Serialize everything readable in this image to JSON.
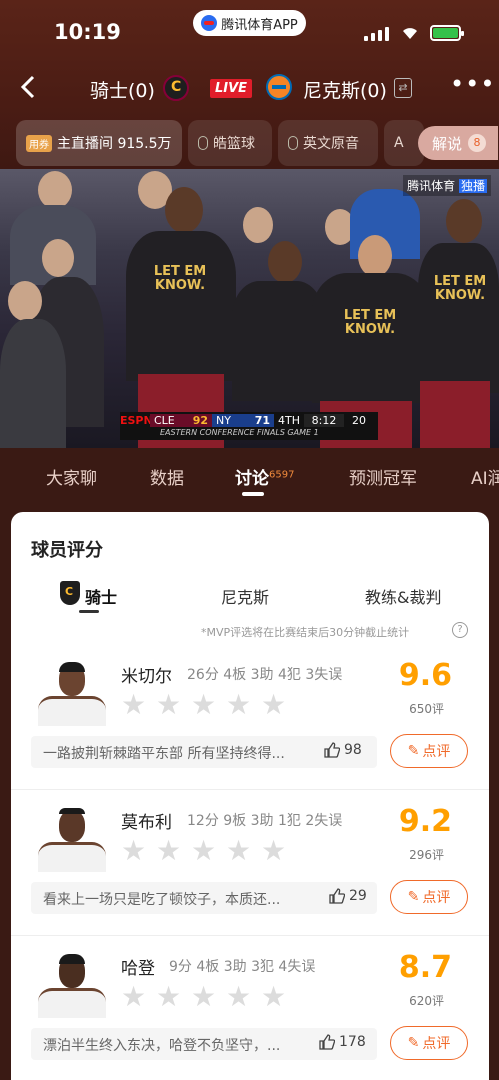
{
  "status_bar": {
    "time": "10:19",
    "app_name": "腾讯体育APP"
  },
  "header": {
    "home_team": "骑士(0)",
    "live_label": "LIVE",
    "away_team": "尼克斯(0)",
    "more_label": "•••"
  },
  "broadcast": {
    "main_tag": "用券",
    "main_label": "主直播间 915.5万",
    "items": [
      "皓篮球",
      "英文原音",
      "A"
    ],
    "explain_label": "解说",
    "explain_count": "8"
  },
  "video": {
    "watermark": "腾讯体育",
    "watermark_badge": "独播",
    "jersey_text": "LET EM KNOW.",
    "scorebug": {
      "network": "ESPN",
      "home": "CLE",
      "home_score": "92",
      "away": "NY",
      "away_score": "71",
      "quarter": "4TH",
      "clock": "8:12",
      "shot_clock": "20",
      "series": "EASTERN CONFERENCE FINALS GAME 1"
    }
  },
  "tabs": [
    {
      "label": "大家聊"
    },
    {
      "label": "数据"
    },
    {
      "label": "讨论",
      "badge": "6597"
    },
    {
      "label": "预测冠军"
    },
    {
      "label": "AI润"
    }
  ],
  "card": {
    "title": "球员评分",
    "sub_tabs": [
      "骑士",
      "尼克斯",
      "教练&裁判"
    ],
    "note": "*MVP评选将在比赛结束后30分钟截止统计",
    "rate_label": "点评",
    "players": [
      {
        "name": "米切尔",
        "stats": "26分 4板 3助 4犯 3失误",
        "score": "9.6",
        "count": "650评",
        "comment": "一路披荆斩棘踏平东部 所有坚持终得...",
        "likes": "98"
      },
      {
        "name": "莫布利",
        "stats": "12分 9板 3助 1犯 2失误",
        "score": "9.2",
        "count": "296评",
        "comment": "看来上一场只是吃了顿饺子，本质还...",
        "likes": "29"
      },
      {
        "name": "哈登",
        "stats": "9分 4板 3助 3犯 4失误",
        "score": "8.7",
        "count": "620评",
        "comment": "漂泊半生终入东决，哈登不负坚守，...",
        "likes": "178"
      }
    ]
  },
  "colors": {
    "accent": "#f06a2a",
    "score": "#ff9f00",
    "live": "#e11d2a",
    "bg": "#3a1a14"
  }
}
